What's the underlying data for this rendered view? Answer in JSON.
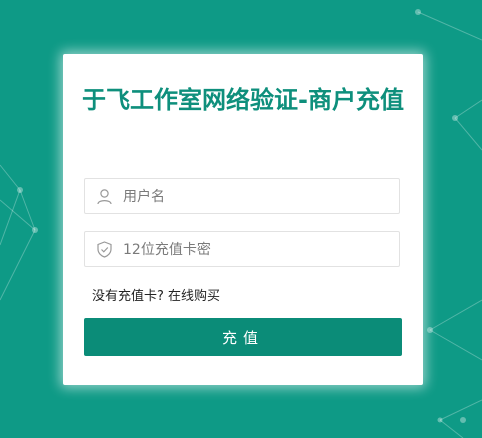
{
  "colors": {
    "background": "#0e9a86",
    "accent": "#0b8c78",
    "title": "#0e8f7c"
  },
  "form": {
    "title": "于飞工作室网络验证-商户充值",
    "username": {
      "value": "",
      "placeholder": "用户名",
      "icon": "user-icon"
    },
    "card_key": {
      "value": "",
      "placeholder": "12位充值卡密",
      "icon": "shield-icon"
    },
    "buy_link": "没有充值卡? 在线购买",
    "submit_label": "充值"
  }
}
